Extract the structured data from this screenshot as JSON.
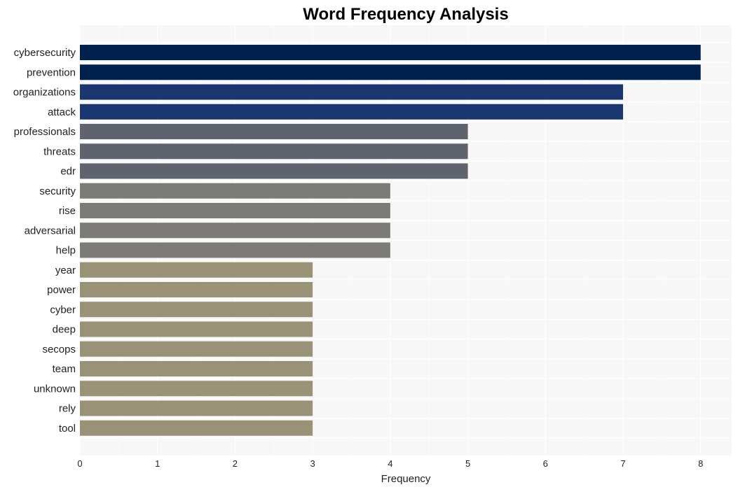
{
  "chart_data": {
    "type": "bar",
    "orientation": "horizontal",
    "title": "Word Frequency Analysis",
    "xlabel": "Frequency",
    "ylabel": "",
    "xlim": [
      0,
      8.4
    ],
    "xticks": [
      0,
      1,
      2,
      3,
      4,
      5,
      6,
      7,
      8
    ],
    "grid": true,
    "categories": [
      "cybersecurity",
      "prevention",
      "organizations",
      "attack",
      "professionals",
      "threats",
      "edr",
      "security",
      "rise",
      "adversarial",
      "help",
      "year",
      "power",
      "cyber",
      "deep",
      "secops",
      "team",
      "unknown",
      "rely",
      "tool"
    ],
    "values": [
      8,
      8,
      7,
      7,
      5,
      5,
      5,
      4,
      4,
      4,
      4,
      3,
      3,
      3,
      3,
      3,
      3,
      3,
      3,
      3
    ],
    "colors_by_value": {
      "8": "#00204e",
      "7": "#1a3670",
      "5": "#5f636e",
      "4": "#7c7b77",
      "3": "#9a9277"
    }
  },
  "style": {
    "plot_background": "#f7f7f7",
    "grid_color": "#ffffff",
    "text_color": "#222222"
  }
}
